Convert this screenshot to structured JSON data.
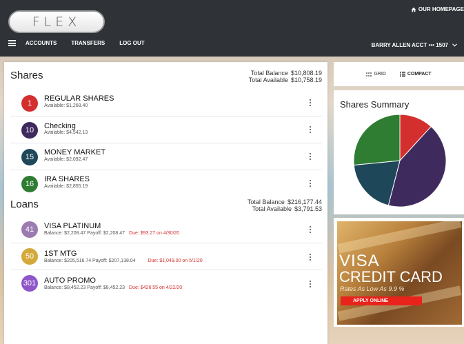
{
  "header": {
    "logo": "FLEX",
    "homepage_link": "OUR HOMEPAGE",
    "nav": [
      "ACCOUNTS",
      "TRANSFERS",
      "LOG OUT"
    ],
    "account_label": "BARRY ALLEN  ACCT ••• 1507"
  },
  "shares": {
    "title": "Shares",
    "total_balance_label": "Total Balance",
    "total_balance": "$10,808.19",
    "total_available_label": "Total Available",
    "total_available": "$10,758.19",
    "items": [
      {
        "id": "1",
        "name": "REGULAR SHARES",
        "sub": "Available: $1,268.40",
        "color": "#d32f2f"
      },
      {
        "id": "10",
        "name": "Checking",
        "sub": "Available: $4,542.13",
        "color": "#3f2a5e"
      },
      {
        "id": "15",
        "name": "MONEY MARKET",
        "sub": "Available: $2,092.47",
        "color": "#1e4759"
      },
      {
        "id": "16",
        "name": "IRA SHARES",
        "sub": "Available: $2,855.19",
        "color": "#2e7d32"
      }
    ]
  },
  "loans": {
    "title": "Loans",
    "total_balance_label": "Total Balance",
    "total_balance": "$216,177.44",
    "total_available_label": "Total Available",
    "total_available": "$3,791.53",
    "items": [
      {
        "id": "41",
        "name": "VISA PLATINUM",
        "sub": "Balance: $2,208.47   Payoff: $2,208.47",
        "due": "Due: $93.27 on 4/30/20",
        "color": "#9b7bb0"
      },
      {
        "id": "50",
        "name": "1ST MTG",
        "sub": "Balance: $205,516.74   Payoff: $207,138.04",
        "due": "Due: $1,049.00 on 5/1/20",
        "color": "#d4a93a"
      },
      {
        "id": "301",
        "name": "AUTO PROMO",
        "sub": "Balance: $8,452.23   Payoff: $8,452.23",
        "due": "Due: $426.55 on 4/22/20",
        "color": "#8e56c9"
      }
    ]
  },
  "view_toggle": {
    "grid": "GRID",
    "compact": "COMPACT"
  },
  "summary": {
    "title": "Shares Summary"
  },
  "chart_data": {
    "type": "pie",
    "title": "Shares Summary",
    "categories": [
      "REGULAR SHARES",
      "Checking",
      "MONEY MARKET",
      "IRA SHARES"
    ],
    "values": [
      1268.4,
      4542.13,
      2092.47,
      2855.19
    ],
    "colors": [
      "#d32f2f",
      "#3f2a5e",
      "#1e4759",
      "#2e7d32"
    ]
  },
  "promo": {
    "line1": "VISA",
    "line2": "CREDIT CARD",
    "rates": "Rates As Low As 9.9 %",
    "button": "APPLY ONLINE"
  }
}
